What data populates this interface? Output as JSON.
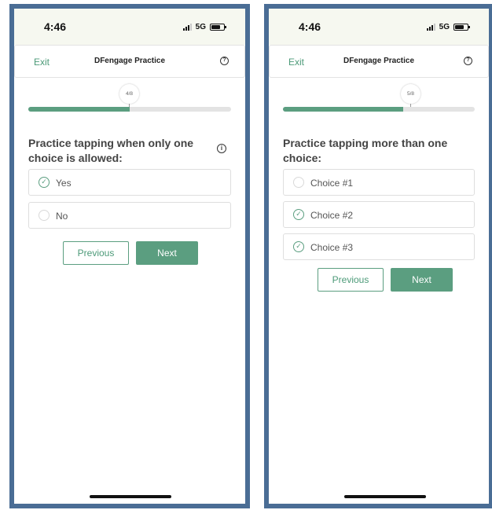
{
  "screens": [
    {
      "status": {
        "time": "4:46",
        "network": "5G"
      },
      "header": {
        "exit_label": "Exit",
        "title": "DFengage Practice",
        "help_icon": "question-circle-icon"
      },
      "progress": {
        "label": "4/8",
        "fraction": 0.5
      },
      "question": {
        "text": "Practice tapping when only one choice is allowed:",
        "has_info_icon": true
      },
      "choices": [
        {
          "label": "Yes",
          "selected": true
        },
        {
          "label": "No",
          "selected": false
        }
      ],
      "buttons": {
        "previous_label": "Previous",
        "next_label": "Next"
      }
    },
    {
      "status": {
        "time": "4:46",
        "network": "5G"
      },
      "header": {
        "exit_label": "Exit",
        "title": "DFengage Practice",
        "help_icon": "question-circle-icon"
      },
      "progress": {
        "label": "5/8",
        "fraction": 0.625
      },
      "question": {
        "text": "Practice tapping more than one choice:",
        "has_info_icon": false
      },
      "choices": [
        {
          "label": "Choice #1",
          "selected": false
        },
        {
          "label": "Choice #2",
          "selected": true
        },
        {
          "label": "Choice #3",
          "selected": true
        }
      ],
      "buttons": {
        "previous_label": "Previous",
        "next_label": "Next"
      }
    }
  ],
  "colors": {
    "accent": "#5b9e80",
    "frame": "#4a6d95",
    "status_bar": "#f6f8f0"
  }
}
